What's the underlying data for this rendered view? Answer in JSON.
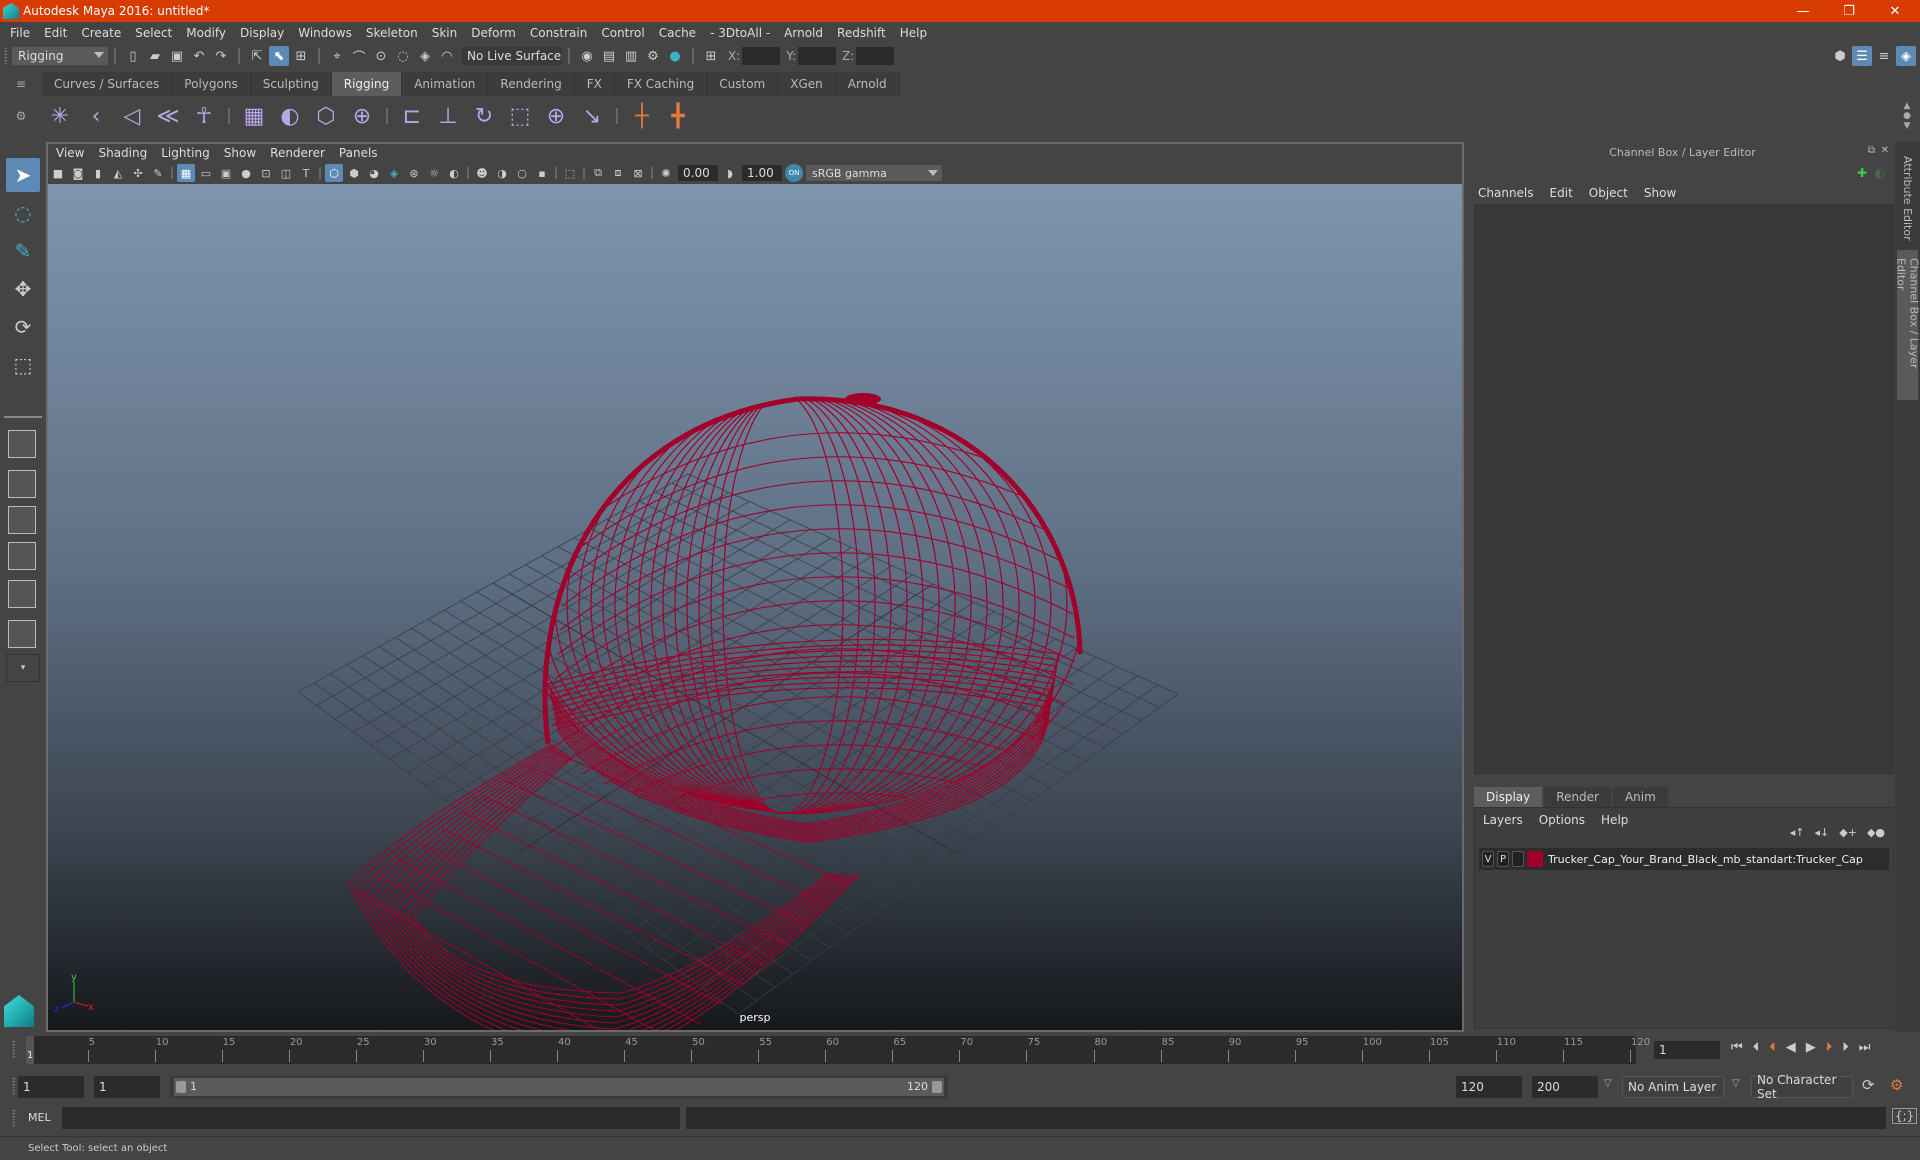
{
  "window": {
    "title": "Autodesk Maya 2016: untitled*",
    "minimize": "—",
    "restore": "❐",
    "close": "✕",
    "accent": "#d83b01"
  },
  "menubar": [
    "File",
    "Edit",
    "Create",
    "Select",
    "Modify",
    "Display",
    "Windows",
    "Skeleton",
    "Skin",
    "Deform",
    "Constrain",
    "Control",
    "Cache",
    "- 3DtoAll -",
    "Arnold",
    "Redshift",
    "Help"
  ],
  "statusline": {
    "menuset": "Rigging",
    "live_surface": "No Live Surface",
    "x_label": "X:",
    "y_label": "Y:",
    "z_label": "Z:",
    "x_value": "",
    "y_value": "",
    "z_value": ""
  },
  "shelf": {
    "tabs": [
      "Curves / Surfaces",
      "Polygons",
      "Sculpting",
      "Rigging",
      "Animation",
      "Rendering",
      "FX",
      "FX Caching",
      "Custom",
      "XGen",
      "Arnold"
    ],
    "active_tab": "Rigging"
  },
  "viewport": {
    "menu": [
      "View",
      "Shading",
      "Lighting",
      "Show",
      "Renderer",
      "Panels"
    ],
    "exposure": "0.00",
    "gamma": "1.00",
    "color_space": "sRGB gamma",
    "camera_label": "persp",
    "axis": {
      "x": "x",
      "y": "y",
      "z": "z"
    },
    "wire_color": "#a0002a"
  },
  "channel_box": {
    "title": "Channel Box / Layer Editor",
    "menu": [
      "Channels",
      "Edit",
      "Object",
      "Show"
    ],
    "layer_tabs": [
      "Display",
      "Render",
      "Anim"
    ],
    "active_layer_tab": "Display",
    "layer_menu": [
      "Layers",
      "Options",
      "Help"
    ],
    "layers": [
      {
        "v": "V",
        "p": "P",
        "color": "#a0002a",
        "name": "Trucker_Cap_Your_Brand_Black_mb_standart:Trucker_Cap"
      }
    ]
  },
  "side_tabs": [
    "Attribute Editor",
    "Channel Box / Layer Editor"
  ],
  "timeline": {
    "ticks": [
      "5",
      "10",
      "15",
      "20",
      "25",
      "30",
      "35",
      "40",
      "45",
      "50",
      "55",
      "60",
      "65",
      "70",
      "75",
      "80",
      "85",
      "90",
      "95",
      "100",
      "105",
      "110",
      "115",
      "120"
    ],
    "current_frame_marker": "1",
    "current_frame": "1"
  },
  "range": {
    "start": "1",
    "playback_start": "1",
    "slider_start": "1",
    "slider_end": "120",
    "playback_end": "120",
    "end": "200",
    "anim_layer": "No Anim Layer",
    "character_set": "No Character Set"
  },
  "mel": {
    "label": "MEL"
  },
  "help_line": "Select Tool: select an object"
}
